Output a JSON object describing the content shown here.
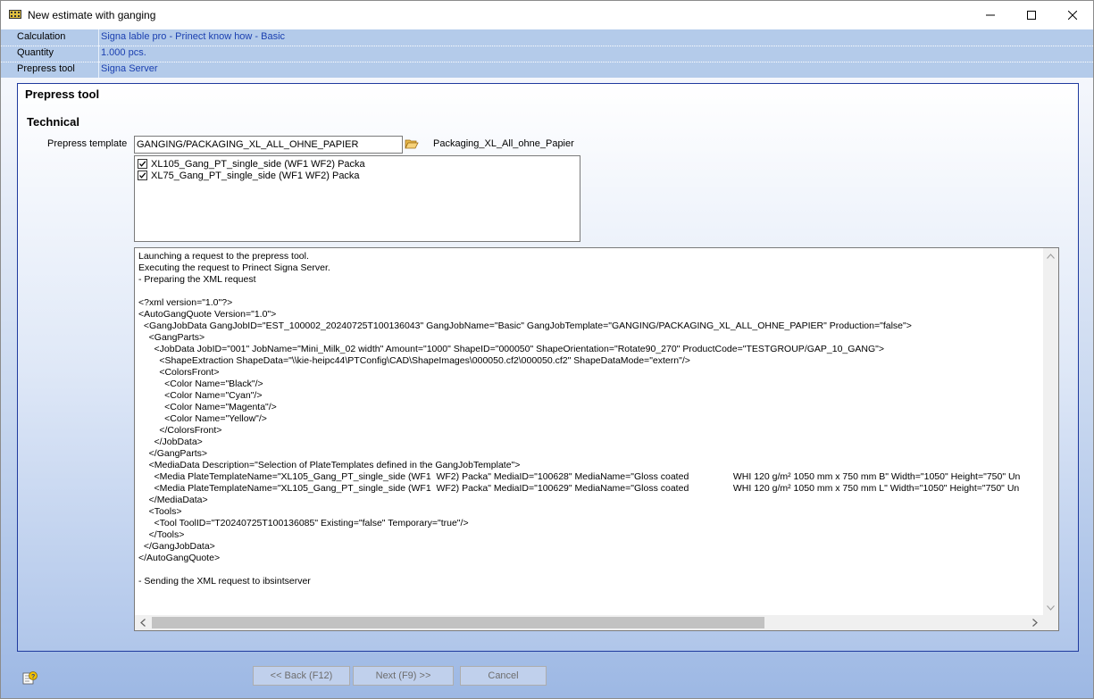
{
  "window": {
    "title": "New estimate with ganging"
  },
  "info": {
    "rows": [
      {
        "label": "Calculation",
        "value": "Signa lable pro - Prinect know how - Basic"
      },
      {
        "label": "Quantity",
        "value": "1.000 pcs."
      },
      {
        "label": "Prepress tool",
        "value": "Signa Server"
      }
    ]
  },
  "panel": {
    "heading": "Prepress tool",
    "subheading": "Technical",
    "template_label": "Prepress template",
    "template_value": "GANGING/PACKAGING_XL_ALL_OHNE_PAPIER",
    "template_name": "Packaging_XL_All_ohne_Papier",
    "items": [
      {
        "label": "XL105_Gang_PT_single_side (WF1  WF2) Packa",
        "checked": true
      },
      {
        "label": "XL75_Gang_PT_single_side (WF1  WF2) Packa",
        "checked": true
      }
    ],
    "log": "Launching a request to the prepress tool.\nExecuting the request to Prinect Signa Server.\n- Preparing the XML request\n\n<?xml version=\"1.0\"?>\n<AutoGangQuote Version=\"1.0\">\n  <GangJobData GangJobID=\"EST_100002_20240725T100136043\" GangJobName=\"Basic\" GangJobTemplate=\"GANGING/PACKAGING_XL_ALL_OHNE_PAPIER\" Production=\"false\">\n    <GangParts>\n      <JobData JobID=\"001\" JobName=\"Mini_Milk_02 width\" Amount=\"1000\" ShapeID=\"000050\" ShapeOrientation=\"Rotate90_270\" ProductCode=\"TESTGROUP/GAP_10_GANG\">\n        <ShapeExtraction ShapeData=\"\\\\kie-heipc44\\PTConfig\\CAD\\ShapeImages\\000050.cf2\\000050.cf2\" ShapeDataMode=\"extern\"/>\n        <ColorsFront>\n          <Color Name=\"Black\"/>\n          <Color Name=\"Cyan\"/>\n          <Color Name=\"Magenta\"/>\n          <Color Name=\"Yellow\"/>\n        </ColorsFront>\n      </JobData>\n    </GangParts>\n    <MediaData Description=\"Selection of PlateTemplates defined in the GangJobTemplate\">\n      <Media PlateTemplateName=\"XL105_Gang_PT_single_side (WF1  WF2) Packa\" MediaID=\"100628\" MediaName=\"Gloss coated                 WHI 120 g/m² 1050 mm x 750 mm B\" Width=\"1050\" Height=\"750\" Un\n      <Media PlateTemplateName=\"XL105_Gang_PT_single_side (WF1  WF2) Packa\" MediaID=\"100629\" MediaName=\"Gloss coated                 WHI 120 g/m² 1050 mm x 750 mm L\" Width=\"1050\" Height=\"750\" Un\n    </MediaData>\n    <Tools>\n      <Tool ToolID=\"T20240725T100136085\" Existing=\"false\" Temporary=\"true\"/>\n    </Tools>\n  </GangJobData>\n</AutoGangQuote>\n\n- Sending the XML request to ibsintserver"
  },
  "buttons": {
    "back": "<< Back (F12)",
    "next": "Next (F9) >>",
    "cancel": "Cancel"
  },
  "colors": {
    "info_band": "#b4cbea",
    "info_value_text": "#1a3fb0",
    "panel_border": "#1f3a9e"
  },
  "icons": {
    "app": "calculator-icon",
    "folder": "folder-open-icon",
    "help": "help-icon"
  }
}
